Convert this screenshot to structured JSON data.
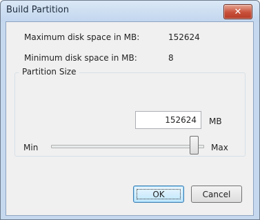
{
  "window": {
    "title": "Build Partition",
    "close_icon": "close-icon"
  },
  "info": {
    "max_label": "Maximum disk space in MB:",
    "max_value": "152624",
    "min_label": "Minimum disk space in MB:",
    "min_value": "8"
  },
  "partition": {
    "group_title": "Partition Size",
    "size_value": "152624",
    "unit": "MB",
    "slider_min_label": "Min",
    "slider_max_label": "Max",
    "slider_level": 1.0
  },
  "buttons": {
    "ok": "OK",
    "cancel": "Cancel"
  },
  "colors": {
    "title_bar": "#c5d8ee",
    "close_button": "#c8503a",
    "client_bg": "#f0f0f0"
  }
}
